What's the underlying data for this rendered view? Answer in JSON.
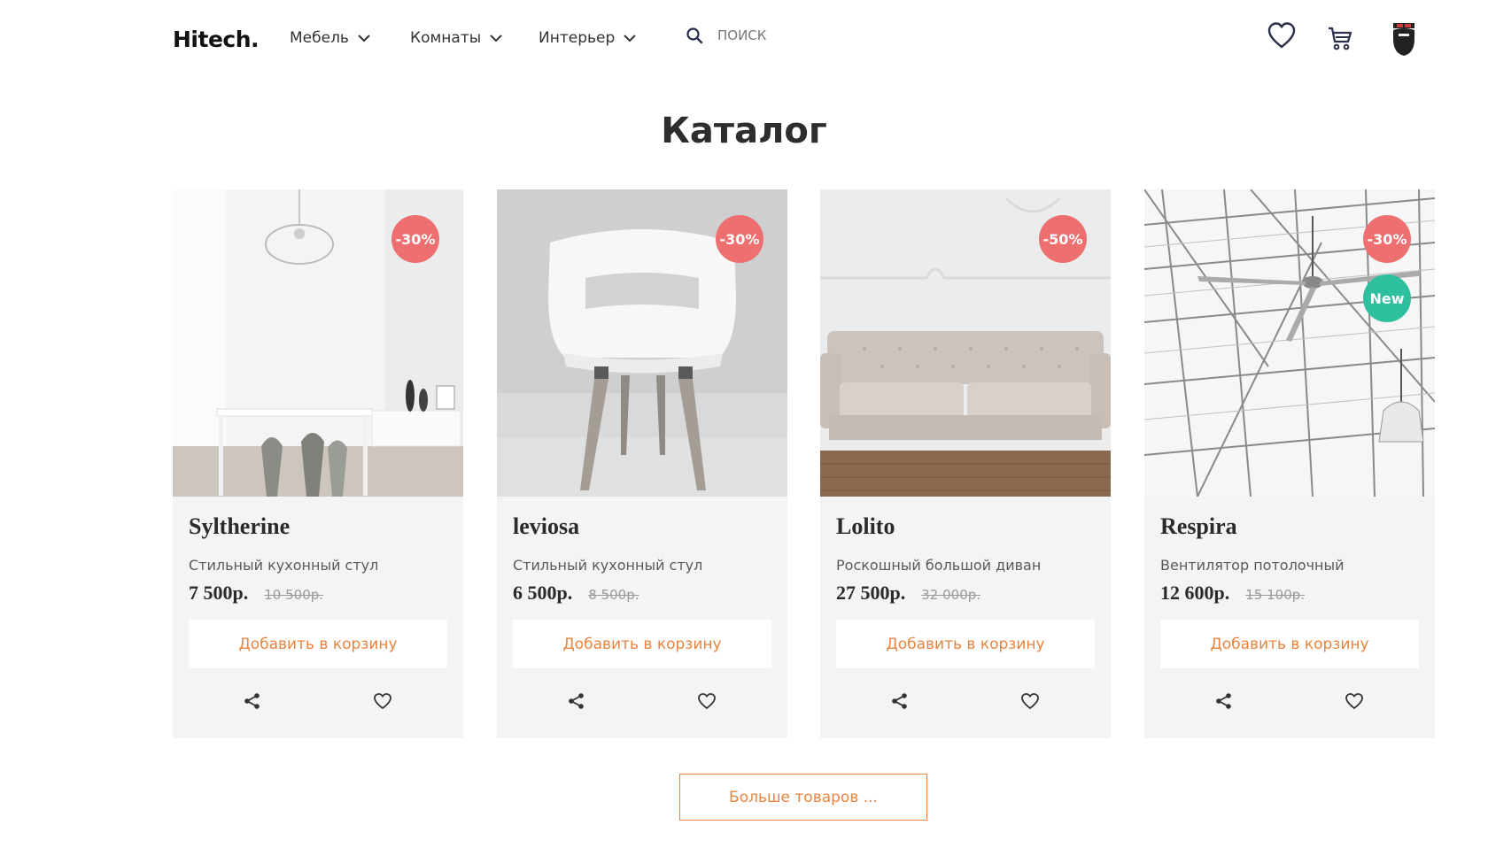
{
  "header": {
    "logo": "Hitech.",
    "nav": [
      {
        "label": "Мебель",
        "icon": "chevron-down-icon"
      },
      {
        "label": "Комнаты",
        "icon": "chevron-down-icon"
      },
      {
        "label": "Интерьер",
        "icon": "chevron-down-icon"
      }
    ],
    "search": {
      "placeholder": "ПОИСК",
      "icon": "search-icon"
    },
    "icons": [
      "heart-icon",
      "cart-icon",
      "avatar"
    ]
  },
  "page_title": "Каталог",
  "colors": {
    "accent": "#e9843f",
    "sale_badge": "#ee6f6f",
    "new_badge": "#2ebf9f",
    "card_bg": "#f3f4f6"
  },
  "products": [
    {
      "name": "Syltherine",
      "description": "Стильный кухонный стул",
      "price": "7 500р.",
      "old_price": "10 500р.",
      "discount": "-30%",
      "new_label": "",
      "add_label": "Добавить в корзину"
    },
    {
      "name": "leviosa",
      "description": "Стильный кухонный стул",
      "price": "6 500р.",
      "old_price": "8 500р.",
      "discount": "-30%",
      "new_label": "",
      "add_label": "Добавить в корзину"
    },
    {
      "name": "Lolito",
      "description": "Роскошный большой диван",
      "price": "27 500р.",
      "old_price": "32 000р.",
      "discount": "-50%",
      "new_label": "",
      "add_label": "Добавить в корзину"
    },
    {
      "name": "Respira",
      "description": "Вентилятор потолочный",
      "price": "12 600р.",
      "old_price": "15 100р.",
      "discount": "-30%",
      "new_label": "New",
      "add_label": "Добавить в корзину"
    }
  ],
  "more_button": "Больше товаров ..."
}
